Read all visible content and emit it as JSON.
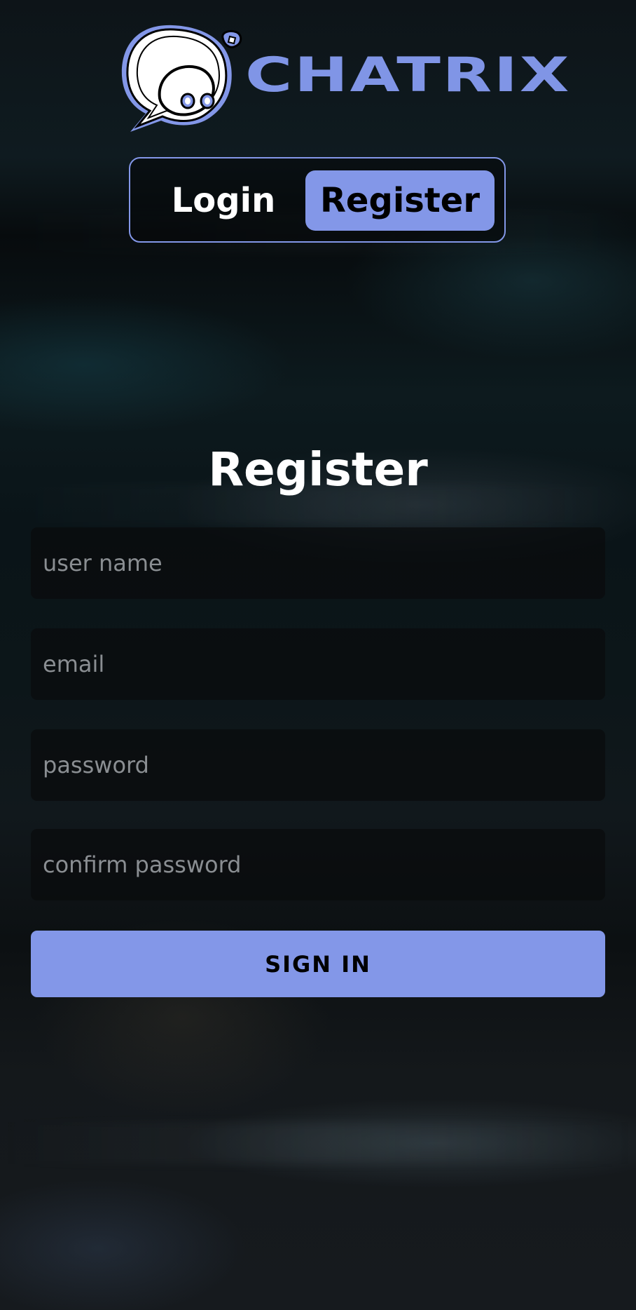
{
  "brand": {
    "name": "CHATRIX",
    "logo_icon": "chat-bubble-face-icon",
    "accent_color": "#8397e8"
  },
  "tabs": [
    {
      "label": "Login",
      "active": false
    },
    {
      "label": "Register",
      "active": true
    }
  ],
  "form": {
    "title": "Register",
    "fields": [
      {
        "placeholder": "user name",
        "value": ""
      },
      {
        "placeholder": "email",
        "value": ""
      },
      {
        "placeholder": "password",
        "value": ""
      },
      {
        "placeholder": "confirm password",
        "value": ""
      }
    ],
    "submit_label": "SIGN IN"
  }
}
